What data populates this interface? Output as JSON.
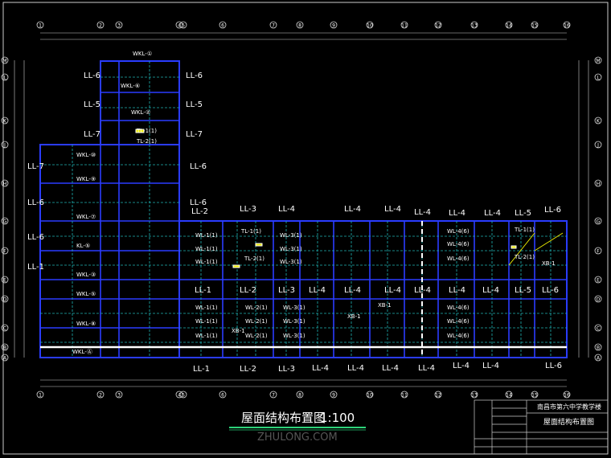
{
  "drawing": {
    "title": "屋面结构布置图",
    "scale": "1:100",
    "watermark": "ZHULONG.COM"
  },
  "title_block": {
    "project": "南昌市第六中学教学楼",
    "sheet_name": "屋面结构布置图"
  },
  "axes_top": [
    "1",
    "2",
    "3",
    "4",
    "5",
    "6",
    "7",
    "8",
    "9",
    "10",
    "11",
    "12",
    "13",
    "14",
    "15",
    "16"
  ],
  "axes_side": [
    "A",
    "B",
    "C",
    "D",
    "E",
    "F",
    "G",
    "H",
    "J",
    "K",
    "L",
    "M"
  ],
  "beam_labels": {
    "ll": [
      "LL-6",
      "LL-6",
      "LL-5",
      "LL-5",
      "LL-7",
      "LL-7",
      "LL-7",
      "LL-6",
      "LL-6",
      "LL-6",
      "LL-6",
      "LL-1",
      "LL-2",
      "LL-3",
      "LL-4",
      "LL-4",
      "LL-4",
      "LL-4",
      "LL-4",
      "LL-4",
      "LL-5",
      "LL-6",
      "LL-1",
      "LL-2",
      "LL-3",
      "LL-4",
      "LL-4",
      "LL-4",
      "LL-4",
      "LL-4",
      "LL-4",
      "LL-5",
      "LL-6",
      "LL-1",
      "LL-2",
      "LL-3",
      "LL-4",
      "LL-4",
      "LL-4",
      "LL-4",
      "LL-4",
      "LL-4",
      "LL-6"
    ],
    "wkl": [
      "WKL-①",
      "WKL-⑥",
      "WKL-②",
      "WKL-⑩",
      "WKL-⑨",
      "WKL-⑦",
      "KL-⑤",
      "WKL-③",
      "WKL-⑤",
      "WKL-⑧",
      "WKL-Ⓐ"
    ],
    "wl": [
      "WL-1(1)",
      "WL-1(1)",
      "WL-1(1)",
      "WL-3(1)",
      "WL-3(1)",
      "WL-3(1)",
      "WL-4(6)",
      "WL-4(6)",
      "WL-4(6)",
      "WL-1(1)",
      "WL-1(1)",
      "WL-1(1)",
      "WL-2(1)",
      "WL-2(1)",
      "WL-2(1)",
      "WL-3(1)",
      "WL-3(1)",
      "WL-3(1)",
      "WL-4(6)",
      "WL-4(6)",
      "WL-4(6)"
    ],
    "tl": [
      "TL-1(1)",
      "TL-2(1)",
      "TL-1(1)",
      "TL-2(1)",
      "TL-1(1)",
      "TL-2(1)"
    ],
    "xb": [
      "XB-1",
      "XB-1",
      "XB-1",
      "XB-1"
    ]
  }
}
